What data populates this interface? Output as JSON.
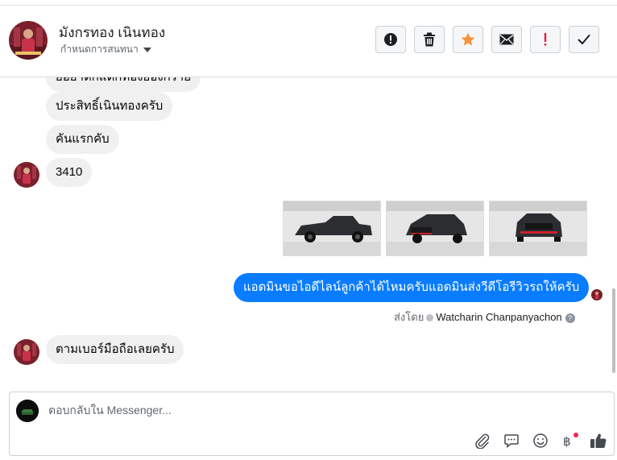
{
  "header": {
    "contact_name": "มังกรทอง เนินทอง",
    "assign_label": "กำหนดการสนทนา",
    "actions": [
      {
        "name": "report-spam-button",
        "icon": "exclamation-circle-icon"
      },
      {
        "name": "delete-button",
        "icon": "trash-icon"
      },
      {
        "name": "star-button",
        "icon": "star-icon",
        "color": "#f7923b"
      },
      {
        "name": "mark-unread-button",
        "icon": "envelope-icon"
      },
      {
        "name": "follow-up-button",
        "icon": "exclamation-icon",
        "color": "#e41e3f"
      },
      {
        "name": "mark-done-button",
        "icon": "checkmark-icon"
      }
    ]
  },
  "thread": {
    "messages": {
      "m0": "ยอยาตกแตกทองยองกราย",
      "m1": "ประสิทธิ์เนินทองครับ",
      "m2": "คันแรกคับ",
      "m3": "3410",
      "m4": "แอดมินขอไอดีไลน์ลูกค้าได้ไหมครับแอดมินส่งวีดีโอรีวิวรถให้ครับ",
      "m5": "ตามเบอร์มือถือเลยครับ"
    },
    "photos": [
      "pickup-truck-side-photo",
      "pickup-truck-front-angle-photo",
      "pickup-truck-front-photo"
    ],
    "sent_by_prefix": "ส่งโดย",
    "sent_by_agent": "Watcharin Chanpanyachon",
    "outgoing_color": "#0a7cff"
  },
  "composer": {
    "placeholder": "ตอบกลับใน Messenger...",
    "icons": [
      "paperclip-icon",
      "saved-reply-icon",
      "emoji-icon",
      "baht-payment-icon",
      "like-icon"
    ]
  }
}
